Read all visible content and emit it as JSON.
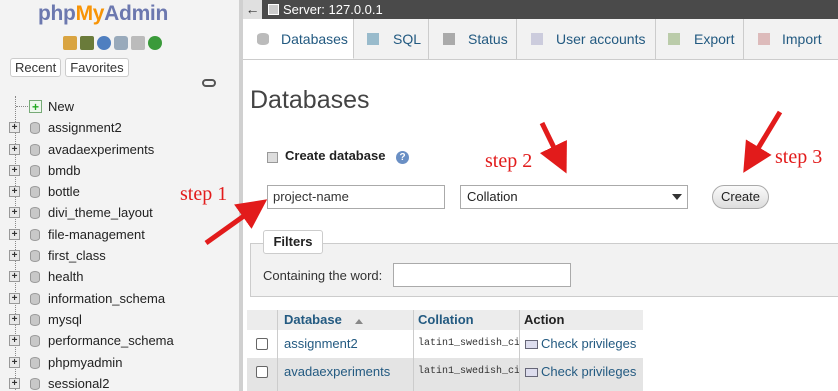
{
  "logo": {
    "php": "php",
    "my": "My",
    "admin": "Admin"
  },
  "nav": {
    "recent_label": "Recent",
    "favorites_label": "Favorites",
    "new_label": "New",
    "databases": [
      "assignment2",
      "avadaexperiments",
      "bmdb",
      "bottle",
      "divi_theme_layout",
      "file-management",
      "first_class",
      "health",
      "information_schema",
      "mysql",
      "performance_schema",
      "phpmyadmin",
      "sessional2"
    ]
  },
  "topbar": {
    "back_icon": "←",
    "server_label": "Server: 127.0.0.1"
  },
  "tabs": [
    "Databases",
    "SQL",
    "Status",
    "User accounts",
    "Export",
    "Import"
  ],
  "main": {
    "page_title": "Databases",
    "create_db_label": "Create database",
    "db_name_value": "project-name",
    "collation_value": "Collation",
    "create_button": "Create",
    "filters_legend": "Filters",
    "containing_label": "Containing the word:"
  },
  "annotations": {
    "step1": "step 1",
    "step2": "step 2",
    "step3": "step 3",
    "color": "#e21b1b"
  },
  "table": {
    "headers": {
      "database": "Database",
      "collation": "Collation",
      "action": "Action"
    },
    "rows": [
      {
        "name": "assignment2",
        "collation": "latin1_swedish_ci",
        "action": "Check privileges"
      },
      {
        "name": "avadaexperiments",
        "collation": "latin1_swedish_ci",
        "action": "Check privileges"
      }
    ]
  }
}
